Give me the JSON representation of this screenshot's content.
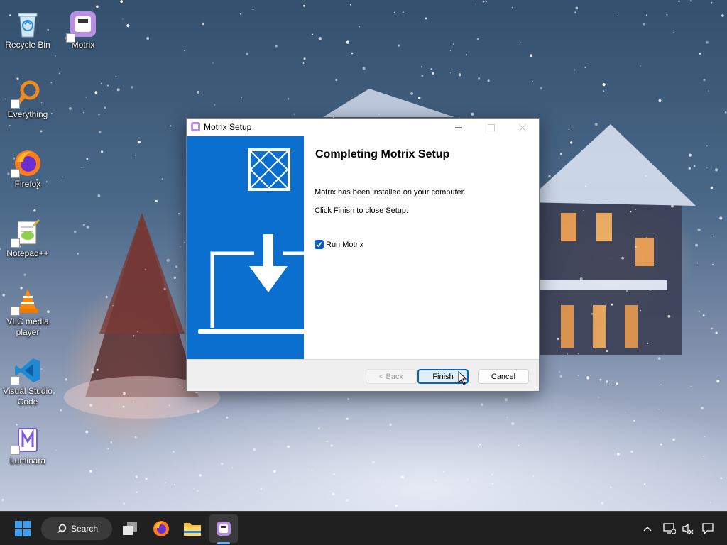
{
  "desktop": {
    "icons": [
      {
        "label": "Recycle Bin"
      },
      {
        "label": "Motrix"
      },
      {
        "label": "Everything"
      },
      {
        "label": "Firefox"
      },
      {
        "label": "Notepad++"
      },
      {
        "label": "VLC media player"
      },
      {
        "label": "Visual Studio Code"
      },
      {
        "label": "Luminara"
      }
    ]
  },
  "dialog": {
    "title": "Motrix Setup",
    "heading": "Completing Motrix Setup",
    "installed_text": "Motrix has been installed on your computer.",
    "finish_text": "Click Finish to close Setup.",
    "run_checkbox": {
      "label": "Run Motrix",
      "checked": true
    },
    "buttons": {
      "back": "< Back",
      "finish": "Finish",
      "cancel": "Cancel"
    },
    "accent_color": "#0b6fd0"
  },
  "taskbar": {
    "search_label": "Search",
    "pinned": [
      "windows-start",
      "task-view",
      "firefox",
      "file-explorer",
      "motrix"
    ],
    "active_app": "motrix"
  }
}
